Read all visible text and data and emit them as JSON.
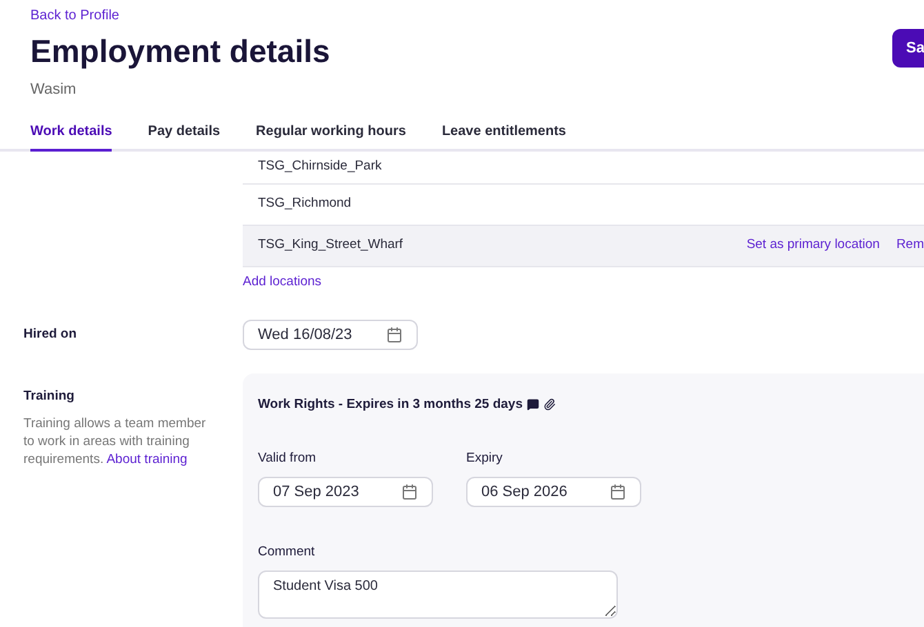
{
  "back_link": "Back to Profile",
  "title": "Employment details",
  "subtitle": "Wasim",
  "save_button": "Sa",
  "tabs": [
    {
      "label": "Work details",
      "selected": true
    },
    {
      "label": "Pay details",
      "selected": false
    },
    {
      "label": "Regular working hours",
      "selected": false
    },
    {
      "label": "Leave entitlements",
      "selected": false
    }
  ],
  "locations": [
    {
      "name": "TSG_Chirnside_Park",
      "highlighted": false
    },
    {
      "name": "TSG_Richmond",
      "highlighted": false
    },
    {
      "name": "TSG_King_Street_Wharf",
      "highlighted": true,
      "actions": [
        "Set as primary location",
        "Rem"
      ]
    }
  ],
  "add_locations": "Add locations",
  "hired_on": {
    "label": "Hired on",
    "value": "Wed 16/08/23"
  },
  "training": {
    "label": "Training",
    "description": "Training allows a team member to work in areas with training requirements.",
    "link": "About training",
    "card": {
      "title": "Work Rights - Expires in 3 months 25 days",
      "valid_from": {
        "label": "Valid from",
        "value": "07 Sep 2023"
      },
      "expiry": {
        "label": "Expiry",
        "value": "06 Sep 2026"
      },
      "comment": {
        "label": "Comment",
        "value": "Student Visa 500"
      }
    }
  }
}
